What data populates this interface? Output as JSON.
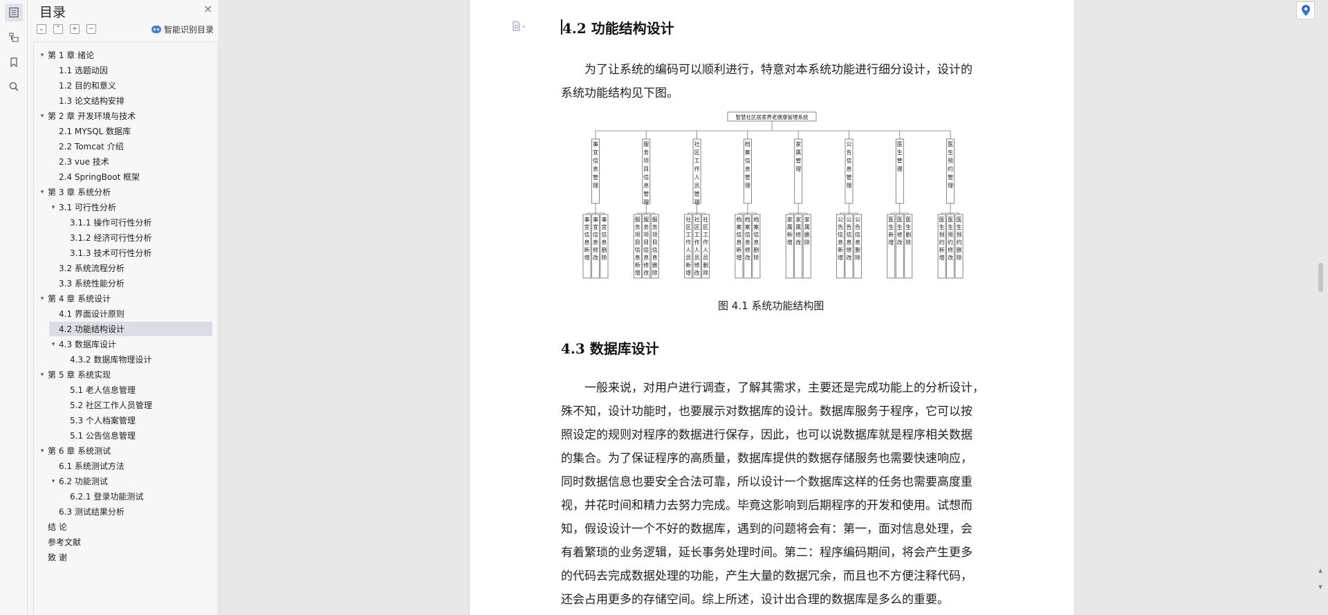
{
  "toc": {
    "title": "目录",
    "close": "×",
    "ai_label": "智能识别目录",
    "items": [
      {
        "label": "第 1 章  绪论",
        "level": 0,
        "arrow": "▾"
      },
      {
        "label": "1.1 选题动因",
        "level": 1,
        "arrow": ""
      },
      {
        "label": "1.2 目的和意义",
        "level": 1,
        "arrow": ""
      },
      {
        "label": "1.3 论文结构安排",
        "level": 1,
        "arrow": ""
      },
      {
        "label": "第 2 章  开发环境与技术",
        "level": 0,
        "arrow": "▾"
      },
      {
        "label": "2.1 MYSQL 数据库",
        "level": 1,
        "arrow": ""
      },
      {
        "label": "2.2 Tomcat  介绍",
        "level": 1,
        "arrow": ""
      },
      {
        "label": "2.3 vue 技术",
        "level": 1,
        "arrow": ""
      },
      {
        "label": "2.4 SpringBoot 框架",
        "level": 1,
        "arrow": ""
      },
      {
        "label": "第 3 章  系统分析",
        "level": 0,
        "arrow": "▾"
      },
      {
        "label": "3.1 可行性分析",
        "level": 1,
        "arrow": "▾"
      },
      {
        "label": "3.1.1 操作可行性分析",
        "level": 2,
        "arrow": ""
      },
      {
        "label": "3.1.2 经济可行性分析",
        "level": 2,
        "arrow": ""
      },
      {
        "label": "3.1.3 技术可行性分析",
        "level": 2,
        "arrow": ""
      },
      {
        "label": "3.2 系统流程分析",
        "level": 1,
        "arrow": ""
      },
      {
        "label": "3.3 系统性能分析",
        "level": 1,
        "arrow": ""
      },
      {
        "label": "第 4 章  系统设计",
        "level": 0,
        "arrow": "▾"
      },
      {
        "label": "4.1 界面设计原则",
        "level": 1,
        "arrow": ""
      },
      {
        "label": "4.2 功能结构设计",
        "level": 1,
        "arrow": "",
        "selected": true
      },
      {
        "label": "4.3 数据库设计",
        "level": 1,
        "arrow": "▾"
      },
      {
        "label": "4.3.2  数据库物理设计",
        "level": 2,
        "arrow": ""
      },
      {
        "label": "第 5 章  系统实现",
        "level": 0,
        "arrow": "▾"
      },
      {
        "label": "5.1 老人信息管理",
        "level": 2,
        "arrow": ""
      },
      {
        "label": "5.2  社区工作人员管理",
        "level": 2,
        "arrow": ""
      },
      {
        "label": "5.3 个人档案管理",
        "level": 2,
        "arrow": ""
      },
      {
        "label": "5.1 公告信息管理",
        "level": 2,
        "arrow": ""
      },
      {
        "label": "第 6 章  系统测试",
        "level": 0,
        "arrow": "▾"
      },
      {
        "label": "6.1  系统测试方法",
        "level": 1,
        "arrow": ""
      },
      {
        "label": "6.2  功能测试",
        "level": 1,
        "arrow": "▾"
      },
      {
        "label": "6.2.1  登录功能测试",
        "level": 2,
        "arrow": ""
      },
      {
        "label": "6.3  测试结果分析",
        "level": 1,
        "arrow": ""
      },
      {
        "label": "结    论",
        "level": 0,
        "arrow": ""
      },
      {
        "label": "参考文献",
        "level": 0,
        "arrow": ""
      },
      {
        "label": "致    谢",
        "level": 0,
        "arrow": ""
      }
    ]
  },
  "doc": {
    "heading1": "4.2 功能结构设计",
    "para1": [
      "为了让系统的编码可以顺利进行，特意对本系统功能进行细分设计，设计的",
      "系统功能结构见下图。"
    ],
    "diagram": {
      "root": "智慧社区居家养老健康管理系统",
      "modules": [
        {
          "name": "事宜信息管理",
          "children": [
            "事宜信息新增",
            "事宜信息修改",
            "事宜信息删除"
          ]
        },
        {
          "name": "服务项目信息管理",
          "children": [
            "服务项目信息新增",
            "服务项目信息修改",
            "服务项目信息删除"
          ]
        },
        {
          "name": "社区工作人员管理",
          "children": [
            "社区工作人员新增",
            "社区工作人员修改",
            "社区工作人员删除"
          ]
        },
        {
          "name": "档案信息管理",
          "children": [
            "档案信息新增",
            "档案信息修改",
            "档案信息删除"
          ]
        },
        {
          "name": "家属管理",
          "children": [
            "家属新增",
            "家属修改",
            "家属删除"
          ]
        },
        {
          "name": "公告信息管理",
          "children": [
            "公告信息新增",
            "公告信息修改",
            "公告信息删除"
          ]
        },
        {
          "name": "医生管理",
          "children": [
            "医生新增",
            "医生修改",
            "医生删除"
          ]
        },
        {
          "name": "医生预约管理",
          "children": [
            "医生预约新增",
            "医生预约修改",
            "医生预约删除"
          ]
        }
      ]
    },
    "caption": "图 4.1  系统功能结构图",
    "heading2": "4.3 数据库设计",
    "para2": [
      "一般来说，对用户进行调查，了解其需求，主要还是完成功能上的分析设计，",
      "殊不知，设计功能时，也要展示对数据库的设计。数据库服务于程序，它可以按",
      "照设定的规则对程序的数据进行保存，因此，也可以说数据库就是程序相关数据",
      "的集合。为了保证程序的高质量，数据库提供的数据存储服务也需要快速响应，",
      "同时数据信息也要安全合法可靠，所以设计一个数据库这样的任务也需要高度重",
      "视，并花时间和精力去努力完成。毕竟这影响到后期程序的开发和使用。试想而",
      "知，假设设计一个不好的数据库，遇到的问题将会有：第一，面对信息处理，会",
      "有着繁琐的业务逻辑，延长事务处理时间。第二：程序编码期间，将会产生更多",
      "的代码去完成数据处理的功能，产生大量的数据冗余，而且也不方便注释代码，",
      "还会占用更多的存储空间。综上所述，设计出合理的数据库是多么的重要。"
    ]
  },
  "rail_icons": [
    "toc-icon",
    "outline-icon",
    "bookmark-icon",
    "search-icon"
  ],
  "colors": {
    "accent": "#3f7fe0",
    "selected_bg": "#d9dee6",
    "panel_bg": "#f7f7f7",
    "canvas_bg": "#e8e8e8"
  }
}
